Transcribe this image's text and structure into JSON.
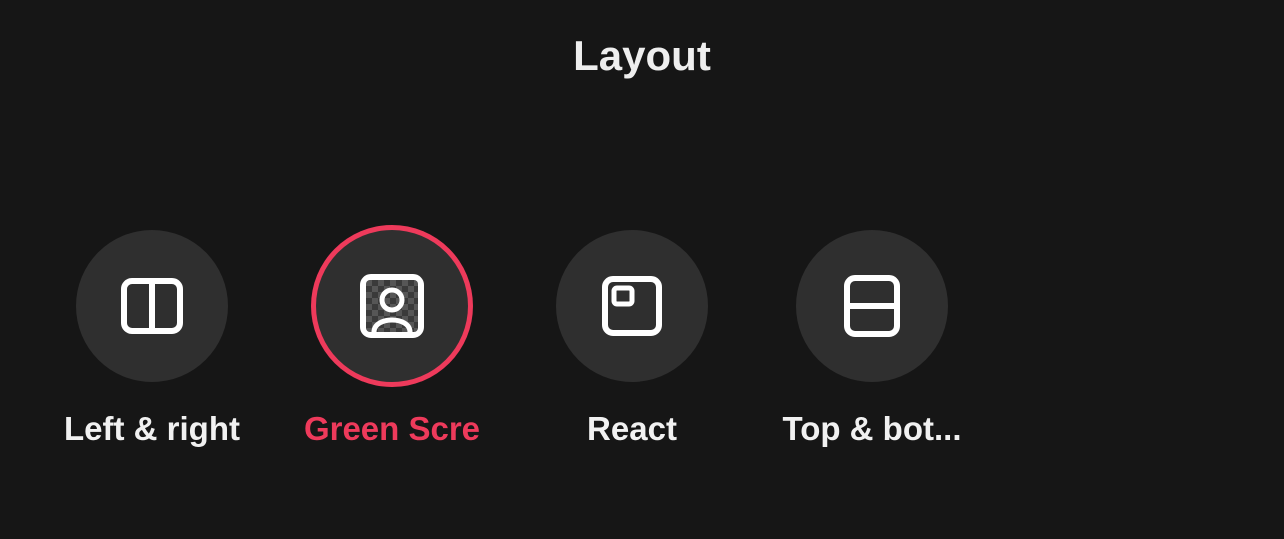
{
  "panel": {
    "title": "Layout"
  },
  "options": [
    {
      "label": "Left & right",
      "selected": false
    },
    {
      "label": "Green Scre",
      "selected": true
    },
    {
      "label": "React",
      "selected": false
    },
    {
      "label": "Top & bot...",
      "selected": false
    }
  ],
  "colors": {
    "accent": "#ee3a5b",
    "circle": "#2f2f2f",
    "text": "#f1f1f1",
    "bg": "#161616"
  }
}
